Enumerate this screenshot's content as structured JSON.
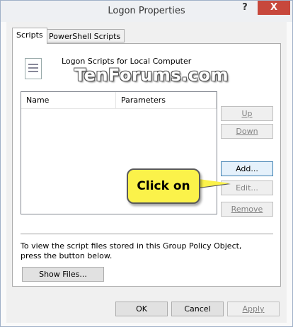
{
  "window": {
    "title": "Logon Properties",
    "help_glyph": "?",
    "close_glyph": "X"
  },
  "tabs": [
    {
      "label": "Scripts",
      "active": true
    },
    {
      "label": "PowerShell Scripts",
      "active": false
    }
  ],
  "scripts_panel": {
    "heading": "Logon Scripts for Local Computer",
    "watermark": "TenForums.com",
    "columns": [
      "Name",
      "Parameters"
    ],
    "rows": [],
    "buttons": {
      "up": "Up",
      "down": "Down",
      "add": "Add...",
      "edit": "Edit...",
      "remove": "Remove"
    },
    "note": "To view the script files stored in this Group Policy Object, press the button below.",
    "show_files": "Show Files..."
  },
  "callout": {
    "text": "Click on",
    "color": "#fbf24a"
  },
  "footer": {
    "ok": "OK",
    "cancel": "Cancel",
    "apply": "Apply"
  }
}
